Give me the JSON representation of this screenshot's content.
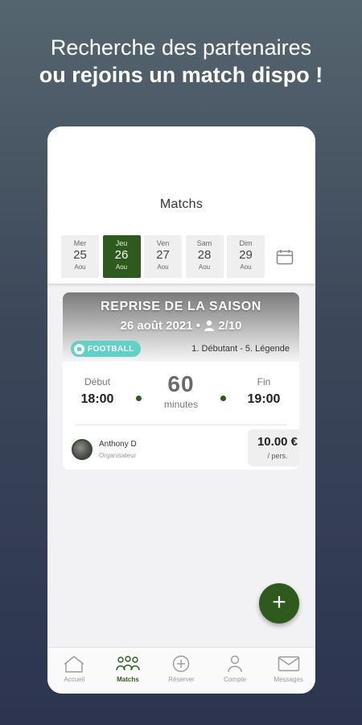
{
  "headline": {
    "line1": "Recherche des partenaires",
    "line2": "ou rejoins un match dispo !"
  },
  "screen": {
    "title": "Matchs"
  },
  "days": [
    {
      "name": "Mer",
      "num": "25",
      "month": "Aou"
    },
    {
      "name": "Jeu",
      "num": "26",
      "month": "Aou"
    },
    {
      "name": "Ven",
      "num": "27",
      "month": "Aou"
    },
    {
      "name": "Sam",
      "num": "28",
      "month": "Aou"
    },
    {
      "name": "Dim",
      "num": "29",
      "month": "Aou"
    }
  ],
  "calendar_icon": "calendar-icon",
  "match": {
    "title": "REPRISE DE LA SAISON",
    "date": "26 août 2021 •",
    "players": "2/10",
    "sport": "FOOTBALL",
    "level": "1. Débutant - 5. Légende",
    "start_label": "Début",
    "start_time": "18:00",
    "duration": "60",
    "duration_unit": "minutes",
    "end_label": "Fin",
    "end_time": "19:00",
    "organizer_name": "Anthony D",
    "organizer_role": "Organisateur",
    "price": "10.00 €",
    "price_unit": "/ pers."
  },
  "fab": {
    "symbol": "+"
  },
  "nav": [
    {
      "label": "Accueil",
      "icon": "home-icon"
    },
    {
      "label": "Matchs",
      "icon": "players-icon"
    },
    {
      "label": "Réserver",
      "icon": "add-circle-icon"
    },
    {
      "label": "Compte",
      "icon": "person-icon"
    },
    {
      "label": "Messages",
      "icon": "mail-icon"
    }
  ],
  "colors": {
    "accent": "#2f5a1e",
    "sport_badge": "#5fd1c7"
  }
}
